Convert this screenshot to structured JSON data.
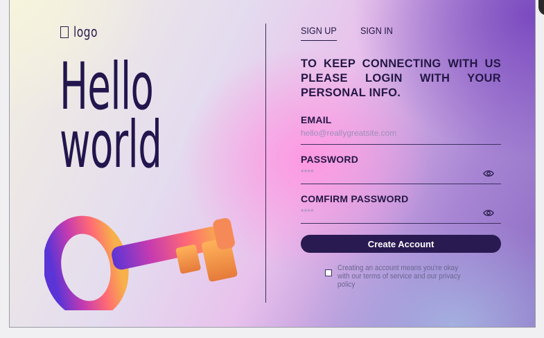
{
  "logo": {
    "text": "logo"
  },
  "hero": {
    "line1": "Hello",
    "line2": "world"
  },
  "tabs": [
    {
      "label": "SIGN UP",
      "active": true
    },
    {
      "label": "SIGN IN",
      "active": false
    }
  ],
  "headline": "TO KEEP CONNECTING WITH US PLEASE LOGIN WITH YOUR PERSONAL INFO.",
  "form": {
    "email": {
      "label": "EMAIL",
      "placeholder": "hello@reallygreatsite.com"
    },
    "password": {
      "label": "PASSWORD",
      "placeholder": "****"
    },
    "confirm": {
      "label": "COMFIRM PASSWORD",
      "placeholder": "****"
    },
    "submit": "Create Account",
    "terms": "Creating an account means you're okay with our terms of service and our privacy policy"
  },
  "icons": {
    "eye": "eye-icon",
    "key": "key-illustration",
    "logo": "logo-box-icon"
  },
  "colors": {
    "primary": "#2a1a52",
    "text": "#241745"
  }
}
